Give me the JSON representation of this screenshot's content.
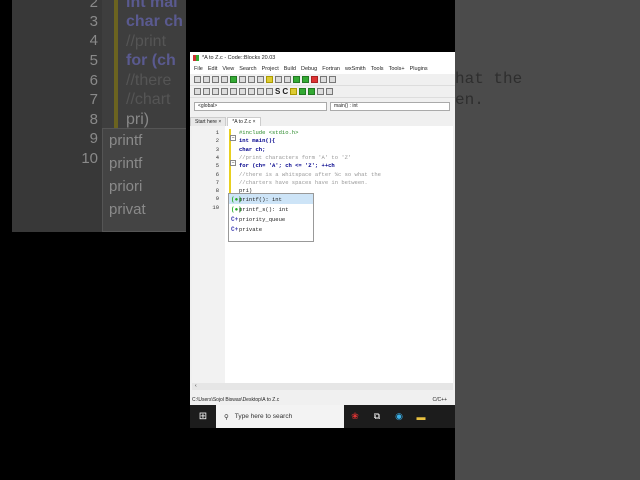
{
  "window": {
    "title": "*A to Z.c - Code::Blocks 20.03"
  },
  "menu": [
    "File",
    "Edit",
    "View",
    "Search",
    "Project",
    "Build",
    "Debug",
    "Fortran",
    "wxSmith",
    "Tools",
    "Tools+",
    "Plugins"
  ],
  "scope": {
    "left": "<global>",
    "right": "main() : int"
  },
  "tabs": [
    {
      "label": "Start here",
      "close": "×"
    },
    {
      "label": "*A to Z.c",
      "close": "×"
    }
  ],
  "code": {
    "line_numbers": [
      "1",
      "2",
      "3",
      "4",
      "5",
      "6",
      "7",
      "8",
      "9",
      "10"
    ],
    "lines": [
      "#include <stdio.h>",
      "int main(){",
      "char ch;",
      "//print characters form 'A' to 'Z'",
      "for (ch= 'A'; ch <= 'Z'; ++ch",
      "//there is a whitspace after %c so what the",
      "//charters have spaces have in between.",
      "pri)",
      "",
      ""
    ]
  },
  "autocomplete": [
    {
      "label": "printf(): int",
      "icon": "function-icon"
    },
    {
      "label": "printf_s(): int",
      "icon": "function-icon"
    },
    {
      "label": "priority_queue",
      "icon": "class-icon"
    },
    {
      "label": "private",
      "icon": "keyword-icon"
    }
  ],
  "status": {
    "path": "C:\\Users\\Sojol Biswas\\Desktop\\A to Z.c",
    "language": "C/C++"
  },
  "taskbar": {
    "search_placeholder": "Type here to search"
  },
  "zoom_left": {
    "line_numbers": [
      "2",
      "3",
      "4",
      "5",
      "6",
      "7",
      "8",
      "9",
      "10"
    ],
    "lines": [
      "int mai",
      "char ch",
      "//print",
      "for (ch",
      "//there",
      "//chart",
      "pri)"
    ],
    "popup": [
      "printf",
      "printf",
      "priori",
      "privat"
    ]
  },
  "zoom_right": {
    "lines": [
      "hat the",
      "en."
    ]
  }
}
